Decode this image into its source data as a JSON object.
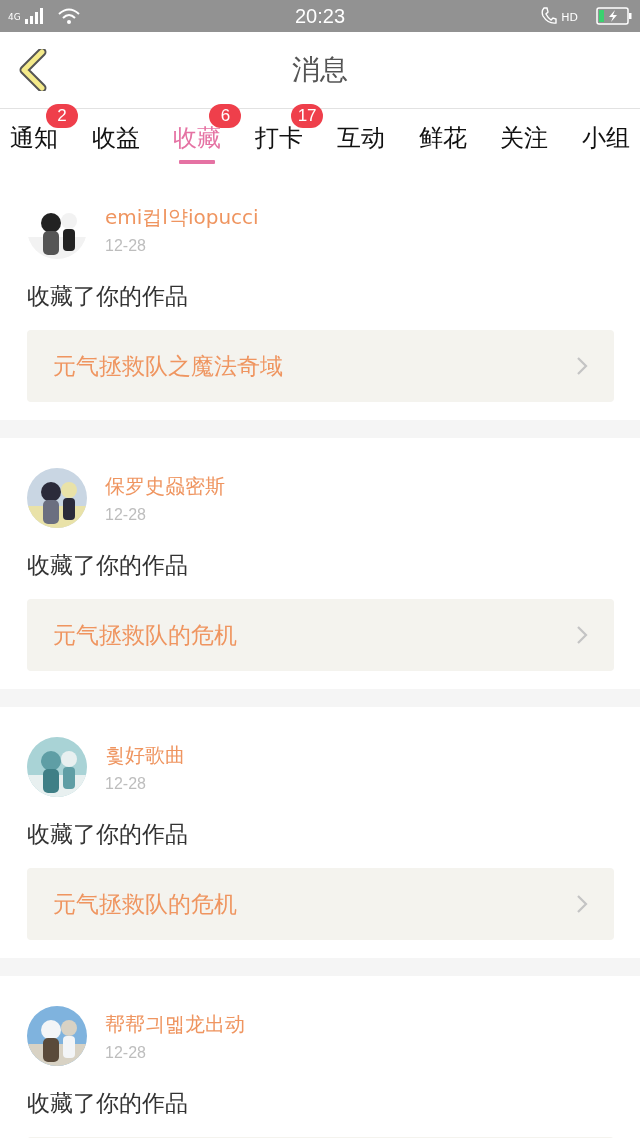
{
  "status_bar": {
    "network": "4G",
    "time": "20:23",
    "call_label": "HD"
  },
  "header": {
    "title": "消息"
  },
  "tabs": [
    {
      "label": "通知",
      "selected": false,
      "badge": "2"
    },
    {
      "label": "收益",
      "selected": false
    },
    {
      "label": "收藏",
      "selected": true,
      "badge": "6"
    },
    {
      "label": "打卡",
      "selected": false,
      "badge": "17"
    },
    {
      "label": "互动",
      "selected": false
    },
    {
      "label": "鲜花",
      "selected": false
    },
    {
      "label": "关注",
      "selected": false
    },
    {
      "label": "小组",
      "selected": false
    }
  ],
  "messages": [
    {
      "user": "emi컵l약iopucci",
      "date": "12-28",
      "action": "收藏了你的作品",
      "work": "元气拯救队之魔法奇域"
    },
    {
      "user": "保罗史赑密斯",
      "date": "12-28",
      "action": "收藏了你的作品",
      "work": "元气拯救队的危机"
    },
    {
      "user": "휯好歌曲",
      "date": "12-28",
      "action": "收藏了你的作品",
      "work": "元气拯救队的危机"
    },
    {
      "user": "帮帮긔멟龙出动",
      "date": "12-28",
      "action": "收藏了你的作品"
    }
  ]
}
